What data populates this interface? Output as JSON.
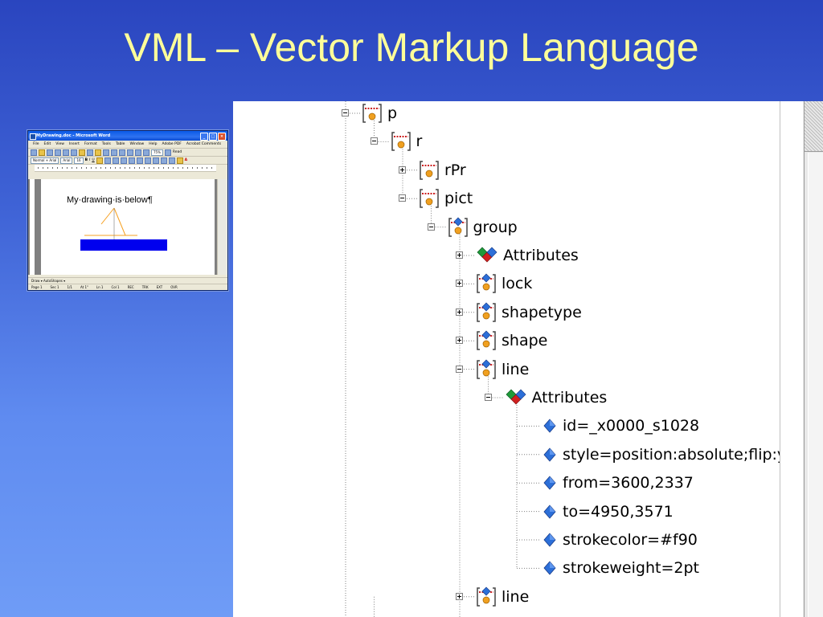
{
  "slide": {
    "title": "VML – Vector Markup Language"
  },
  "word_window": {
    "title": "MyDrawing.doc - Microsoft Word",
    "menu": [
      "File",
      "Edit",
      "View",
      "Insert",
      "Format",
      "Tools",
      "Table",
      "Window",
      "Help",
      "Adobe PDF",
      "Acrobat Comments"
    ],
    "style_box": "Normal + Arial",
    "font_box": "Arial",
    "size_box": "16",
    "zoom_box": "75%",
    "read_label": "Read",
    "document_text": "My·drawing·is·below¶",
    "drawing_toolbar": "Draw ▾  AutoShapes ▾",
    "status": [
      "Page 1",
      "Sec 1",
      "1/1",
      "At 1\"",
      "Ln 1",
      "Col 1",
      "REC",
      "TRK",
      "EXT",
      "OVR"
    ]
  },
  "tree": {
    "nodes": [
      {
        "label": "p",
        "expander": "minus",
        "icon": "element-icon"
      },
      {
        "label": "r",
        "expander": "minus",
        "icon": "element-icon"
      },
      {
        "label": "rPr",
        "expander": "plus",
        "icon": "element-icon"
      },
      {
        "label": "pict",
        "expander": "minus",
        "icon": "element-icon"
      },
      {
        "label": "group",
        "expander": "minus",
        "icon": "namespace-element-icon"
      },
      {
        "label": "Attributes",
        "expander": "plus",
        "icon": "attributes-icon"
      },
      {
        "label": "lock",
        "expander": "plus",
        "icon": "namespace-element-icon"
      },
      {
        "label": "shapetype",
        "expander": "plus",
        "icon": "namespace-element-icon"
      },
      {
        "label": "shape",
        "expander": "plus",
        "icon": "namespace-element-icon"
      },
      {
        "label": "line",
        "expander": "minus",
        "icon": "namespace-element-icon"
      },
      {
        "label": "Attributes",
        "expander": "minus",
        "icon": "attributes-icon"
      },
      {
        "label": "id=_x0000_s1028",
        "expander": "none",
        "icon": "attribute-icon"
      },
      {
        "label": "style=position:absolute;flip:y",
        "expander": "none",
        "icon": "attribute-icon"
      },
      {
        "label": "from=3600,2337",
        "expander": "none",
        "icon": "attribute-icon"
      },
      {
        "label": "to=4950,3571",
        "expander": "none",
        "icon": "attribute-icon"
      },
      {
        "label": "strokecolor=#f90",
        "expander": "none",
        "icon": "attribute-icon"
      },
      {
        "label": "strokeweight=2pt",
        "expander": "none",
        "icon": "attribute-icon"
      },
      {
        "label": "line",
        "expander": "plus",
        "icon": "namespace-element-icon"
      }
    ]
  },
  "colors": {
    "title": "#ffff99",
    "background_top": "#2a45bf",
    "background_bottom": "#6f9cf6",
    "bracket_red": "#cc2020",
    "element_ball": "#f0a020",
    "diamond_blue": "#2c6fd8",
    "diamond_green": "#1f9a3a",
    "diamond_red": "#d02020",
    "drawing_orange": "#f6a020",
    "drawing_blue": "#0000ee"
  }
}
